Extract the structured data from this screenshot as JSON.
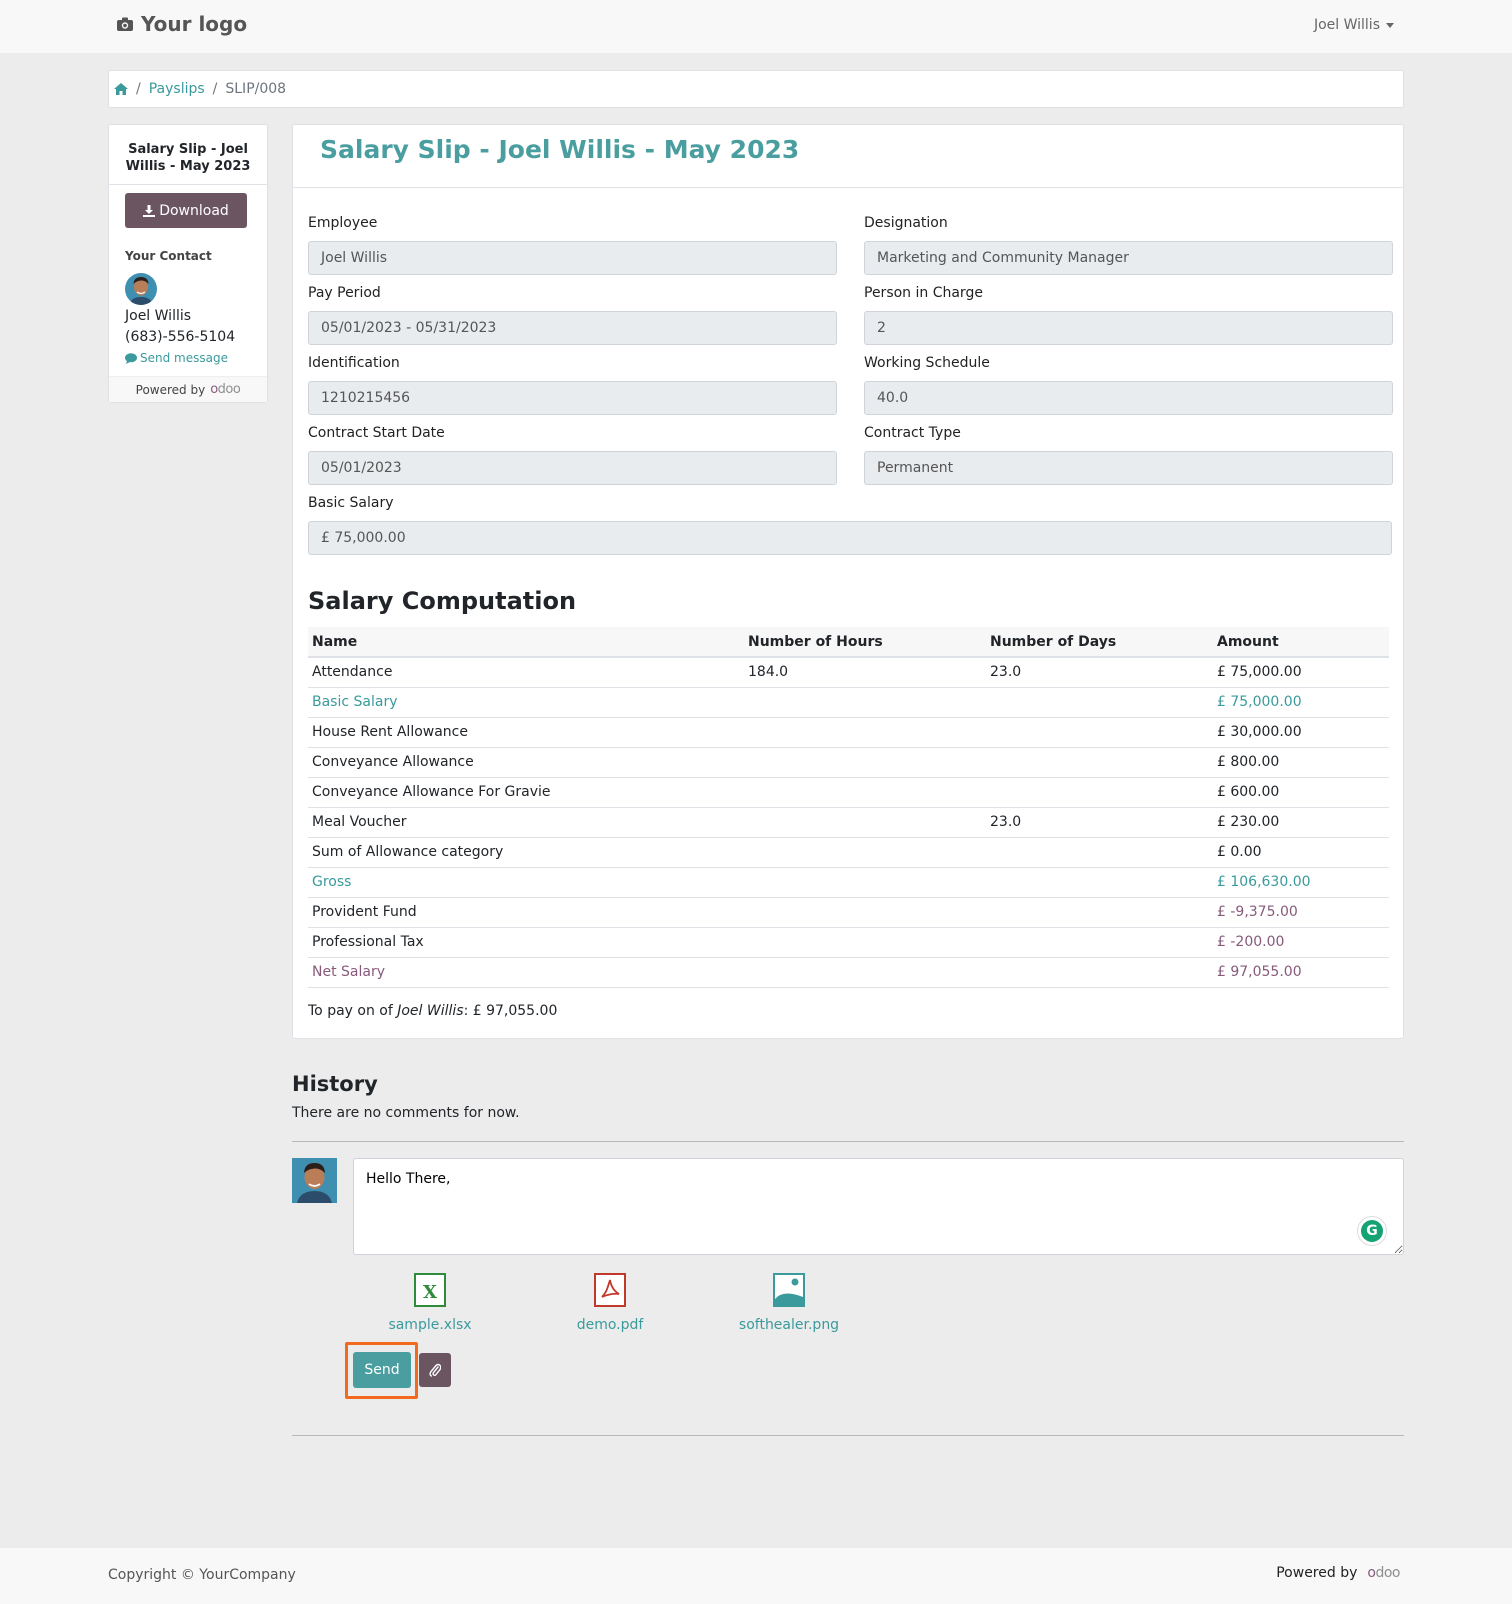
{
  "header": {
    "logo_text": "Your logo",
    "user_name": "Joel Willis"
  },
  "breadcrumb": {
    "items": [
      "Payslips",
      "SLIP/008"
    ]
  },
  "sidebar": {
    "title": "Salary Slip - Joel Willis - May 2023",
    "download_label": "Download",
    "contact_heading": "Your Contact",
    "contact_name": "Joel Willis",
    "contact_phone": "(683)-556-5104",
    "send_message_label": "Send message",
    "powered_by": "Powered by"
  },
  "slip": {
    "title": "Salary Slip - Joel Willis - May 2023",
    "fields": {
      "employee": {
        "label": "Employee",
        "value": "Joel Willis"
      },
      "designation": {
        "label": "Designation",
        "value": "Marketing and Community Manager"
      },
      "pay_period": {
        "label": "Pay Period",
        "value": "05/01/2023 - 05/31/2023"
      },
      "person_in_charge": {
        "label": "Person in Charge",
        "value": "2"
      },
      "identification": {
        "label": "Identification",
        "value": "1210215456"
      },
      "working_schedule": {
        "label": "Working Schedule",
        "value": "40.0"
      },
      "contract_start": {
        "label": "Contract Start Date",
        "value": "05/01/2023"
      },
      "contract_type": {
        "label": "Contract Type",
        "value": "Permanent"
      },
      "basic_salary": {
        "label": "Basic Salary",
        "value": "£ 75,000.00"
      }
    },
    "computation_title": "Salary Computation",
    "columns": [
      "Name",
      "Number of Hours",
      "Number of Days",
      "Amount"
    ],
    "rows": [
      {
        "name": "Attendance",
        "hours": "184.0",
        "days": "23.0",
        "amount": "£ 75,000.00",
        "style": "normal"
      },
      {
        "name": "Basic Salary",
        "hours": "",
        "days": "",
        "amount": "£ 75,000.00",
        "style": "teal"
      },
      {
        "name": "House Rent Allowance",
        "hours": "",
        "days": "",
        "amount": "£ 30,000.00",
        "style": "normal"
      },
      {
        "name": "Conveyance Allowance",
        "hours": "",
        "days": "",
        "amount": "£ 800.00",
        "style": "normal"
      },
      {
        "name": "Conveyance Allowance For Gravie",
        "hours": "",
        "days": "",
        "amount": "£ 600.00",
        "style": "normal"
      },
      {
        "name": "Meal Voucher",
        "hours": "",
        "days": "23.0",
        "amount": "£ 230.00",
        "style": "normal"
      },
      {
        "name": "Sum of Allowance category",
        "hours": "",
        "days": "",
        "amount": "£ 0.00",
        "style": "normal"
      },
      {
        "name": "Gross",
        "hours": "",
        "days": "",
        "amount": "£ 106,630.00",
        "style": "teal"
      },
      {
        "name": "Provident Fund",
        "hours": "",
        "days": "",
        "amount": "£ -9,375.00",
        "style": "neg"
      },
      {
        "name": "Professional Tax",
        "hours": "",
        "days": "",
        "amount": "£ -200.00",
        "style": "neg"
      },
      {
        "name": "Net Salary",
        "hours": "",
        "days": "",
        "amount": "£ 97,055.00",
        "style": "plum"
      }
    ],
    "to_pay_prefix": "To pay on of",
    "to_pay_name": "Joel Willis",
    "to_pay_amount": ": £ 97,055.00"
  },
  "history": {
    "title": "History",
    "empty_text": "There are no comments for now.",
    "message_value": "Hello There,",
    "attachments": [
      "sample.xlsx",
      "demo.pdf",
      "softhealer.png"
    ],
    "send_label": "Send"
  },
  "footer": {
    "copyright": "Copyright © YourCompany",
    "powered_by": "Powered by"
  },
  "colors": {
    "accent": "#4a9ea0",
    "secondary": "#6b5561",
    "plum": "#875a7b",
    "highlight": "#f26a1b"
  }
}
